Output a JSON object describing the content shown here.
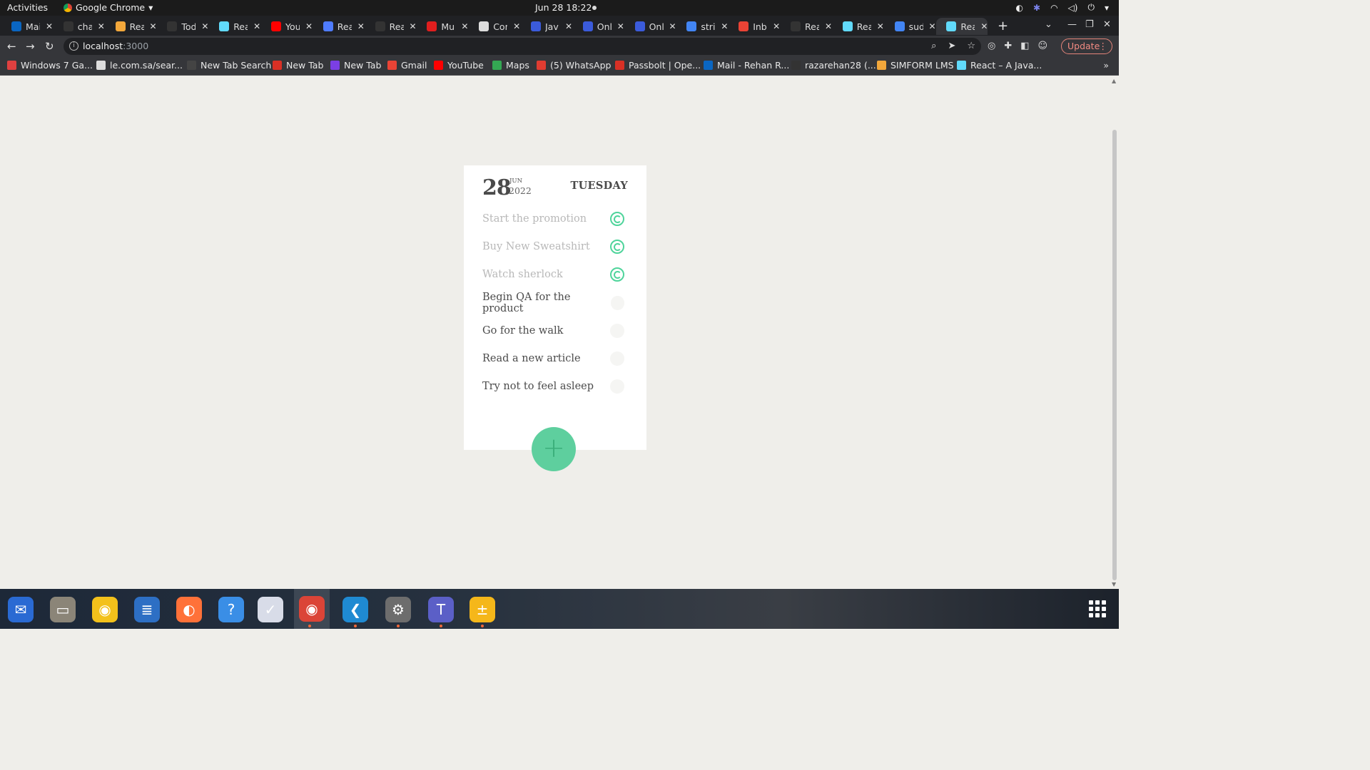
{
  "topbar": {
    "activities": "Activities",
    "app_name": "Google Chrome",
    "clock": "Jun 28  18:22"
  },
  "tabs": [
    {
      "title": "Mai",
      "color": "#0a66c2"
    },
    {
      "title": "cha",
      "color": "#333333"
    },
    {
      "title": "Rea",
      "color": "#f2a73b"
    },
    {
      "title": "Tod",
      "color": "#333333"
    },
    {
      "title": "Rea",
      "color": "#61dafb"
    },
    {
      "title": "You",
      "color": "#ff0000"
    },
    {
      "title": "Rea",
      "color": "#4f7cff"
    },
    {
      "title": "Rea",
      "color": "#333333"
    },
    {
      "title": "Mul",
      "color": "#e01e1e"
    },
    {
      "title": "Con",
      "color": "#dddddd"
    },
    {
      "title": "Jav",
      "color": "#3b5bdb"
    },
    {
      "title": "Onl",
      "color": "#3b5bdb"
    },
    {
      "title": "Onl",
      "color": "#3b5bdb"
    },
    {
      "title": "stri",
      "color": "#4285f4"
    },
    {
      "title": "Inb",
      "color": "#ea4335"
    },
    {
      "title": "Rea",
      "color": "#333333"
    },
    {
      "title": "Rea",
      "color": "#61dafb"
    },
    {
      "title": "sud",
      "color": "#4285f4"
    },
    {
      "title": "Rea",
      "color": "#61dafb",
      "active": true
    }
  ],
  "address": {
    "host": "localhost",
    "port": ":3000"
  },
  "update_label": "Update",
  "bookmarks": [
    {
      "label": "Windows 7 Ga...",
      "color": "#e04040"
    },
    {
      "label": "le.com.sa/sear...",
      "color": "#dddddd"
    },
    {
      "label": "New Tab Search",
      "color": "#444444"
    },
    {
      "label": "New Tab",
      "color": "#d93025"
    },
    {
      "label": "New Tab",
      "color": "#7b3fe4"
    },
    {
      "label": "Gmail",
      "color": "#ea4335"
    },
    {
      "label": "YouTube",
      "color": "#ff0000"
    },
    {
      "label": "Maps",
      "color": "#34a853"
    },
    {
      "label": "(5) WhatsApp",
      "color": "#e03c31"
    },
    {
      "label": "Passbolt | Ope...",
      "color": "#d93025"
    },
    {
      "label": "Mail - Rehan R...",
      "color": "#0a66c2"
    },
    {
      "label": "razarehan28 (...",
      "color": "#333333"
    },
    {
      "label": "SIMFORM LMS",
      "color": "#f2a73b"
    },
    {
      "label": "React – A Java...",
      "color": "#61dafb"
    }
  ],
  "card": {
    "day": "28",
    "month": "JUN",
    "year": "2022",
    "weekday": "TUESDAY",
    "todos": [
      {
        "text": "Start the promotion",
        "done": true
      },
      {
        "text": "Buy New Sweatshirt",
        "done": true
      },
      {
        "text": "Watch sherlock",
        "done": true
      },
      {
        "text": "Begin QA for the product",
        "done": false
      },
      {
        "text": "Go for the walk",
        "done": false
      },
      {
        "text": "Read a new article",
        "done": false
      },
      {
        "text": "Try not to feel asleep",
        "done": false
      }
    ],
    "add_symbol": "+"
  },
  "colors": {
    "accent_green": "#5ecf9e",
    "check_green": "#4fd49b",
    "page_bg": "#efeeea"
  },
  "dock": [
    {
      "name": "thunderbird-icon",
      "color": "#2a6ad3",
      "glyph": "✉"
    },
    {
      "name": "files-icon",
      "color": "#8b8578",
      "glyph": "▭"
    },
    {
      "name": "rhythmbox-icon",
      "color": "#f3c11b",
      "glyph": "◉"
    },
    {
      "name": "writer-icon",
      "color": "#2d6fc4",
      "glyph": "≣"
    },
    {
      "name": "firefox-icon",
      "color": "#ff7139",
      "glyph": "◐"
    },
    {
      "name": "help-icon",
      "color": "#3a8ee6",
      "glyph": "?"
    },
    {
      "name": "timeshift-icon",
      "color": "#d8dce8",
      "glyph": "✓"
    },
    {
      "name": "chrome-icon",
      "color": "#db4437",
      "glyph": "◉",
      "active": true
    },
    {
      "name": "vscode-icon",
      "color": "#1f8ad2",
      "glyph": "❮"
    },
    {
      "name": "settings-icon",
      "color": "#6d6d6d",
      "glyph": "⚙"
    },
    {
      "name": "teams-icon",
      "color": "#5b5fc7",
      "glyph": "T"
    },
    {
      "name": "calculator-icon",
      "color": "#f5b71a",
      "glyph": "±"
    }
  ]
}
